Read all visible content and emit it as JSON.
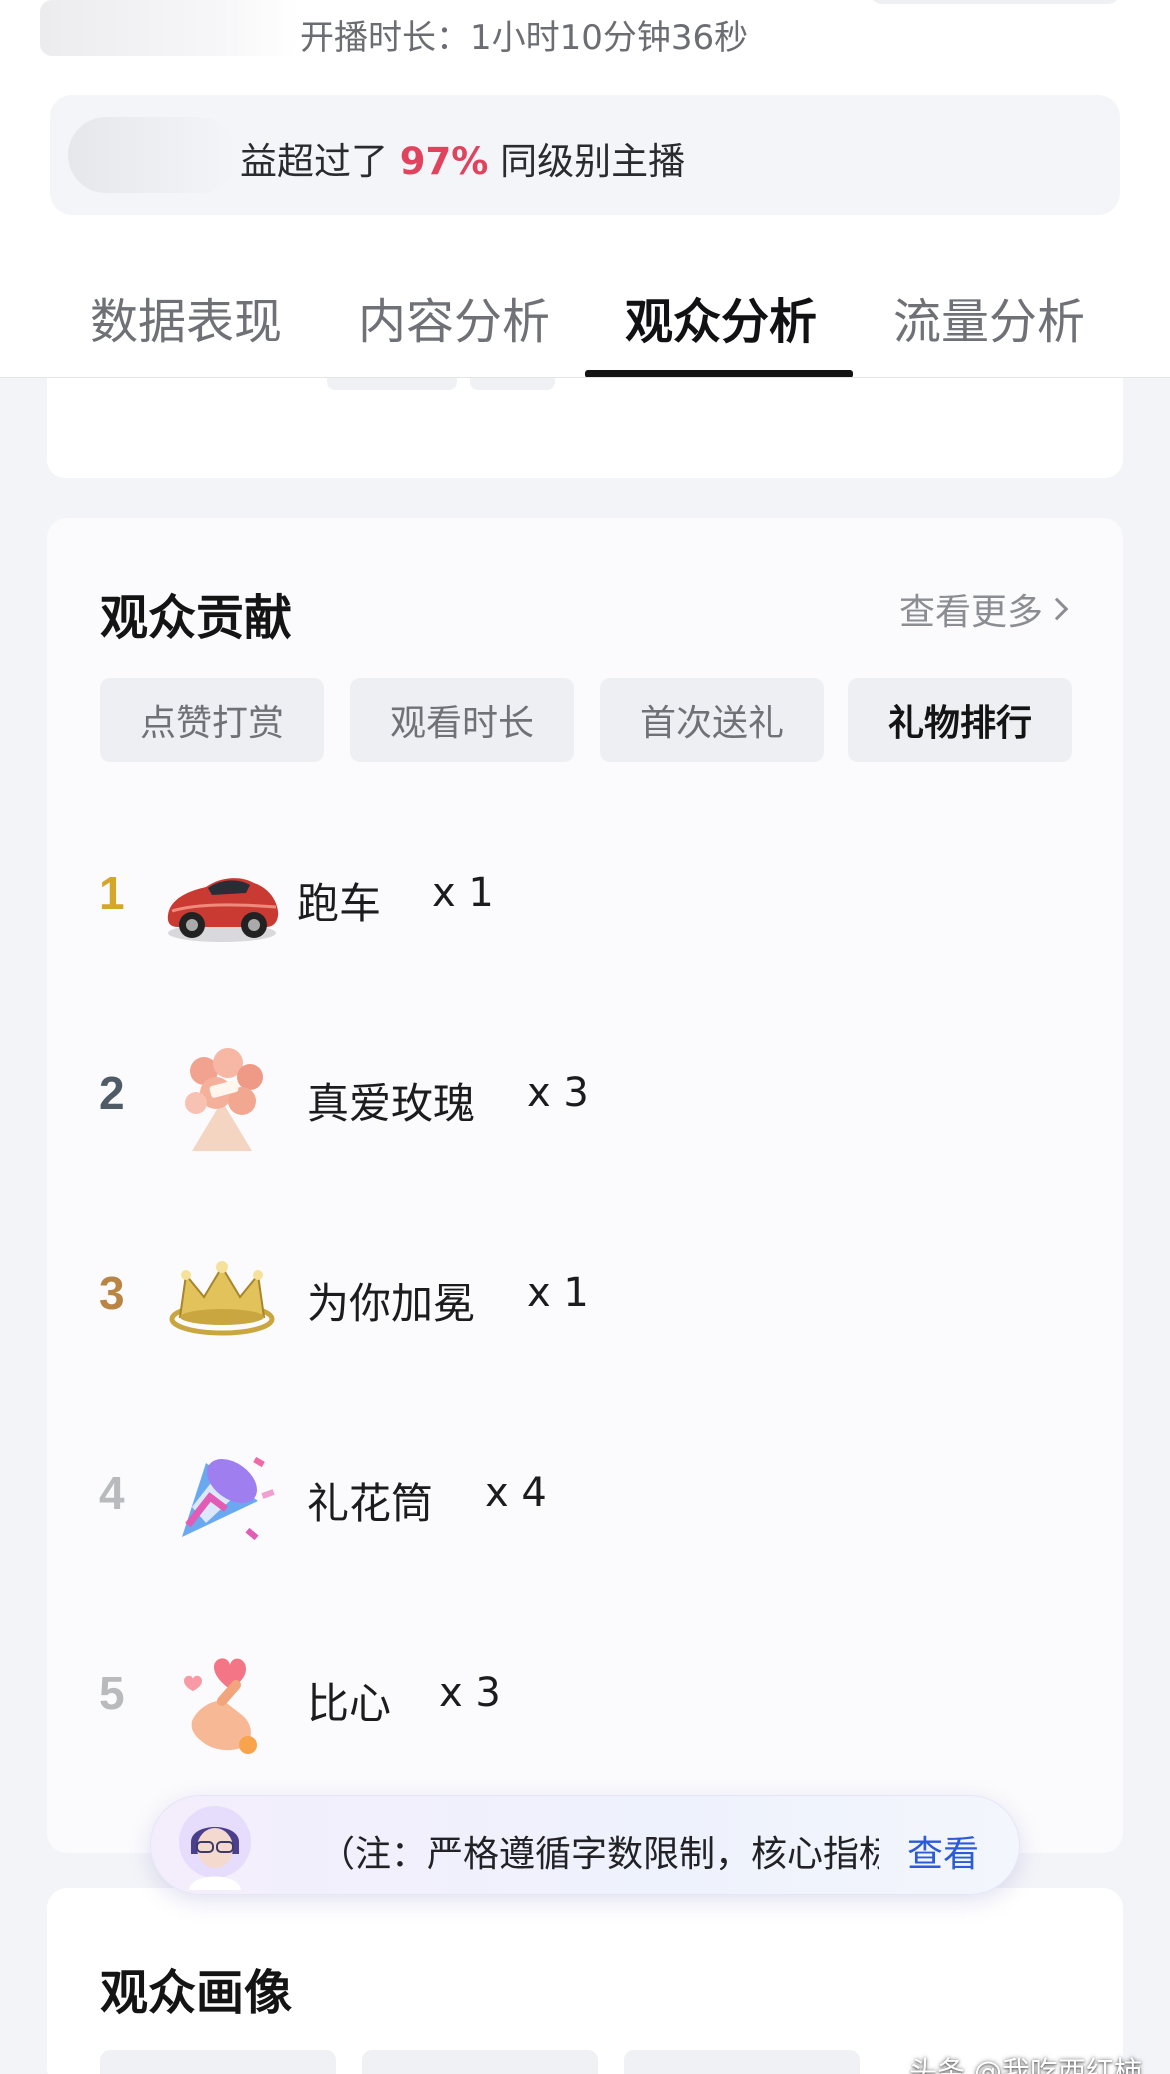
{
  "header": {
    "duration_text": "开播时长：1小时10分钟36秒",
    "rank_text_prefix": "益超过了",
    "rank_percent": "97%",
    "rank_text_suffix": "同级别主播"
  },
  "tabs": [
    {
      "label": "数据表现",
      "active": false
    },
    {
      "label": "内容分析",
      "active": false
    },
    {
      "label": "观众分析",
      "active": true
    },
    {
      "label": "流量分析",
      "active": false
    }
  ],
  "contribution": {
    "title": "观众贡献",
    "view_more": "查看更多",
    "filters": [
      {
        "label": "点赞打赏",
        "active": false
      },
      {
        "label": "观看时长",
        "active": false
      },
      {
        "label": "首次送礼",
        "active": false
      },
      {
        "label": "礼物排行",
        "active": true
      }
    ],
    "gifts": [
      {
        "rank": "1",
        "name": "跑车",
        "count": "x 1",
        "icon": "sports-car-icon",
        "rank_color": "#d4a62a"
      },
      {
        "rank": "2",
        "name": "真爱玫瑰",
        "count": "x 3",
        "icon": "rose-bouquet-icon",
        "rank_color": "#4f5b66"
      },
      {
        "rank": "3",
        "name": "为你加冕",
        "count": "x 1",
        "icon": "crown-icon",
        "rank_color": "#b98545"
      },
      {
        "rank": "4",
        "name": "礼花筒",
        "count": "x 4",
        "icon": "confetti-cannon-icon",
        "rank_color": "#b8babe"
      },
      {
        "rank": "5",
        "name": "比心",
        "count": "x 3",
        "icon": "finger-heart-icon",
        "rank_color": "#b8babe"
      }
    ]
  },
  "ai_bar": {
    "text": "（注：严格遵循字数限制，核心指标",
    "link": "查看"
  },
  "portrait": {
    "title": "观众画像"
  },
  "watermark": "头条 @我吃西红柿",
  "colors": {
    "accent_red": "#e0435d",
    "link_blue": "#2b5bd7"
  }
}
